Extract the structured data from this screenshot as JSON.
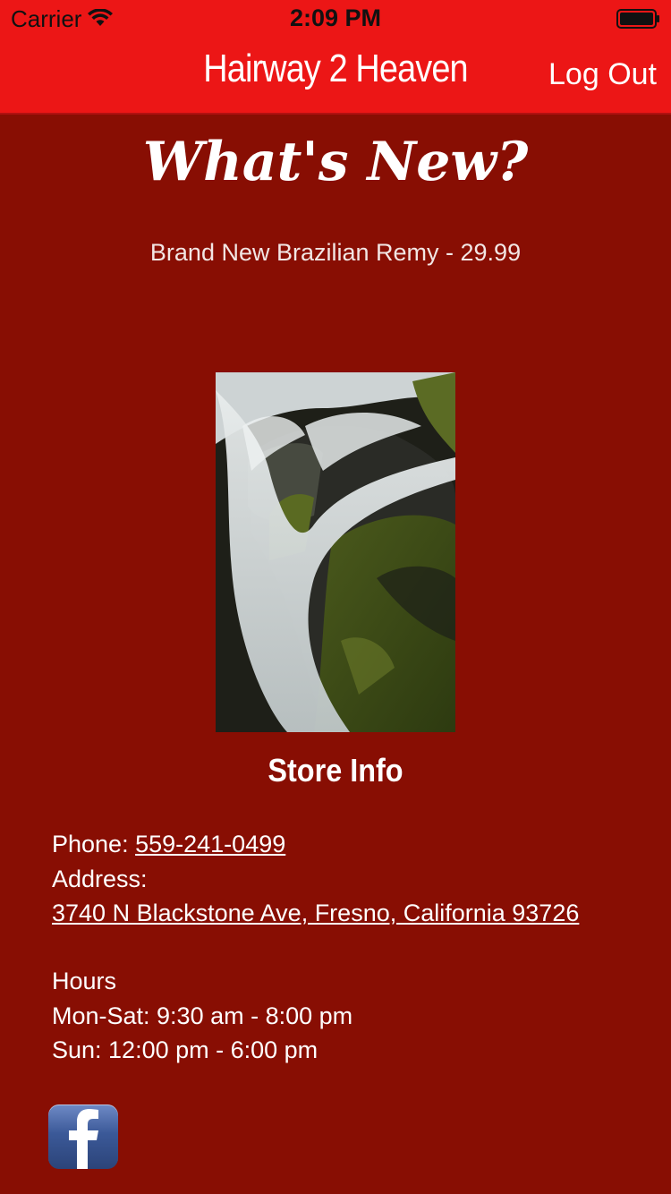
{
  "status_bar": {
    "carrier": "Carrier",
    "time": "2:09 PM"
  },
  "nav": {
    "title": "Hairway 2 Heaven",
    "logout_label": "Log Out"
  },
  "main": {
    "heading": "What's New?",
    "promo_text": "Brand New Brazilian Remy - 29.99",
    "image_icon": "waterfall-photo"
  },
  "store_info": {
    "heading": "Store Info",
    "phone_label": "Phone:",
    "phone_value": "559-241-0499",
    "address_label": "Address:",
    "address_value": "3740 N Blackstone Ave, Fresno, California 93726",
    "hours_label": "Hours",
    "hours_weekday": "Mon-Sat: 9:30 am - 8:00 pm",
    "hours_sunday": "Sun: 12:00 pm - 6:00 pm"
  },
  "social": {
    "icon": "facebook-icon"
  },
  "colors": {
    "nav_bar": "#ec1616",
    "background": "#880e03",
    "facebook": "#3b5998"
  }
}
